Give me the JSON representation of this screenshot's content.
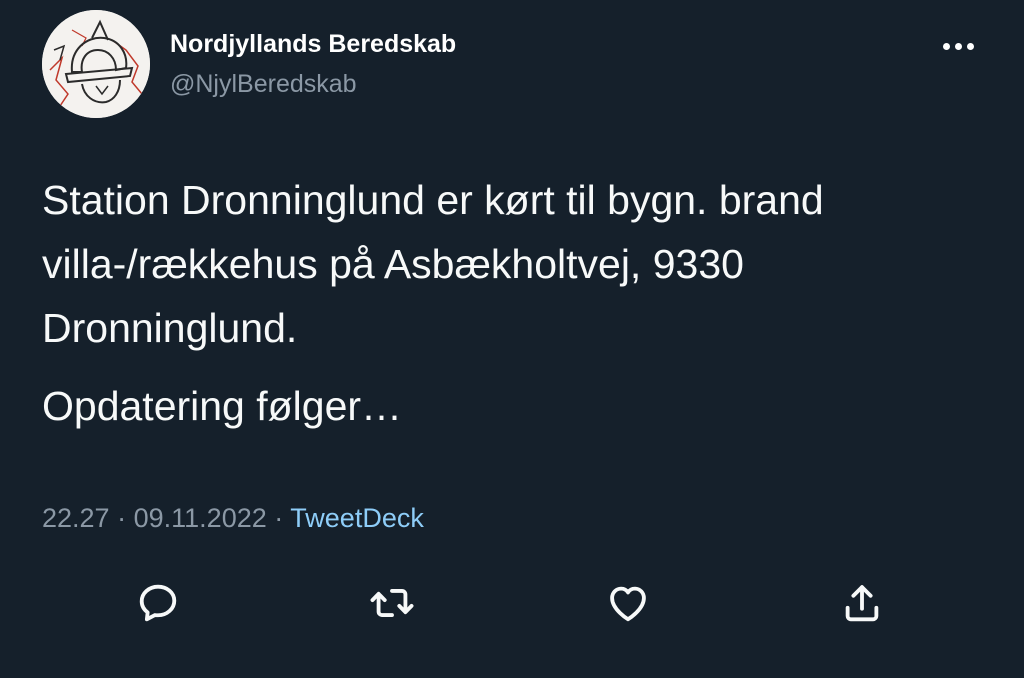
{
  "author": {
    "display_name": "Nordjyllands Beredskab",
    "handle": "@NjylBeredskab",
    "avatar_icon": "firefighter-helmet-logo"
  },
  "tweet": {
    "lines": [
      "Station Dronninglund er kørt til bygn. brand",
      "villa-/rækkehus på Asbækholtvej, 9330",
      "Dronninglund."
    ],
    "second_paragraph": "Opdatering følger…"
  },
  "meta": {
    "time": "22.27",
    "separator": "·",
    "date": "09.11.2022",
    "source": "TweetDeck"
  },
  "actions": {
    "reply_icon": "reply-icon",
    "retweet_icon": "retweet-icon",
    "like_icon": "heart-icon",
    "share_icon": "share-icon"
  },
  "colors": {
    "background": "#15202b",
    "text": "#f7f9f9",
    "secondary": "#8b98a5",
    "link": "#8ecdf8"
  }
}
